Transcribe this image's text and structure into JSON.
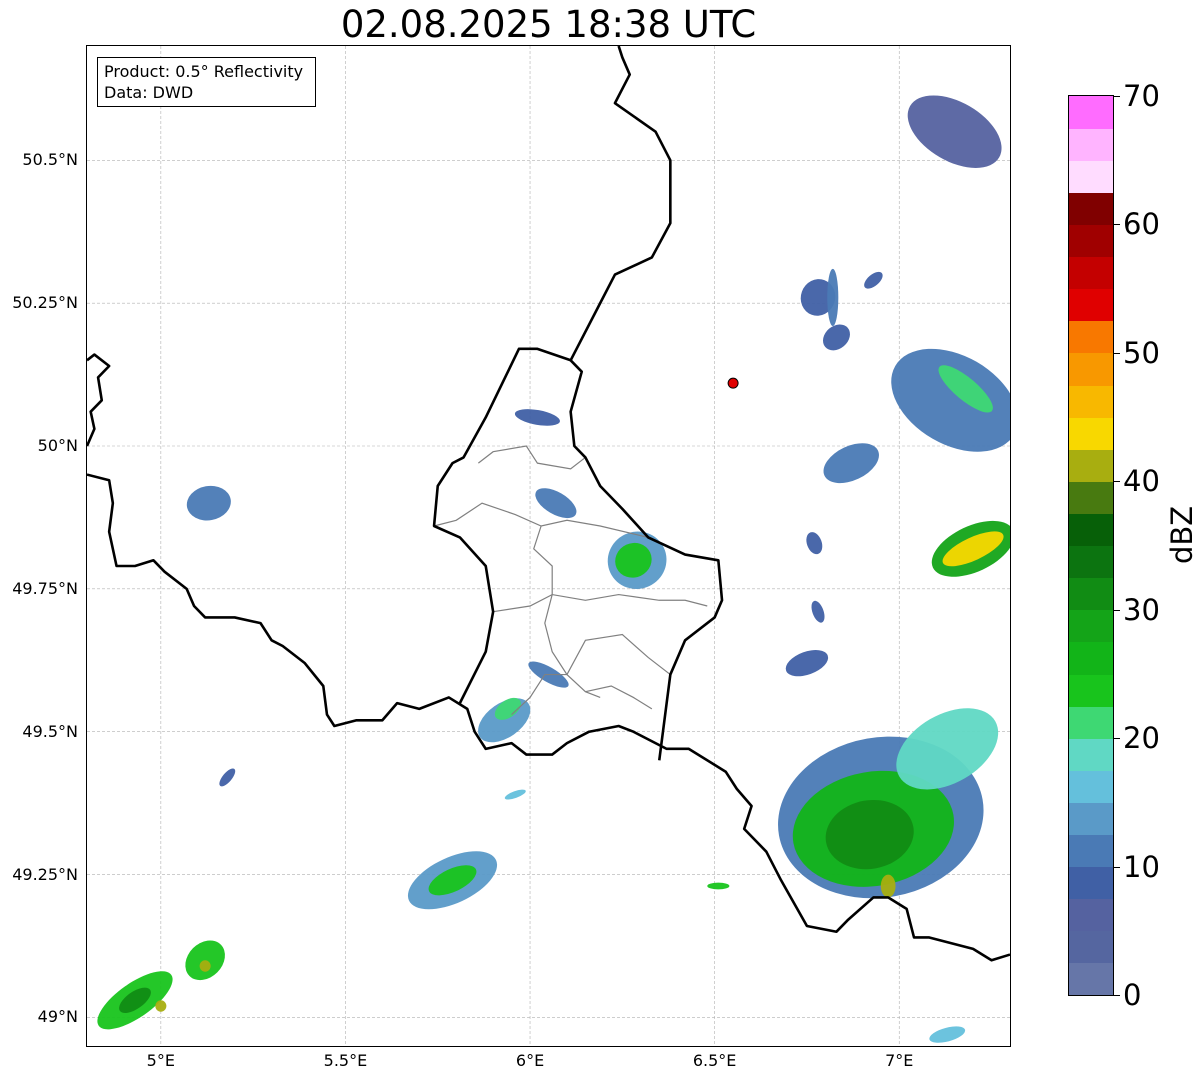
{
  "title": "02.08.2025 18:38 UTC",
  "info_box": {
    "product": "Product: 0.5° Reflectivity",
    "source": "Data: DWD"
  },
  "map": {
    "lon_range": [
      4.8,
      7.3
    ],
    "lat_range": [
      48.95,
      50.7
    ],
    "lat_ticks": [
      {
        "value": 49.0,
        "label": "49°N"
      },
      {
        "value": 49.25,
        "label": "49.25°N"
      },
      {
        "value": 49.5,
        "label": "49.5°N"
      },
      {
        "value": 49.75,
        "label": "49.75°N"
      },
      {
        "value": 50.0,
        "label": "50°N"
      },
      {
        "value": 50.25,
        "label": "50.25°N"
      },
      {
        "value": 50.5,
        "label": "50.5°N"
      }
    ],
    "lon_ticks": [
      {
        "value": 5.0,
        "label": "5°E"
      },
      {
        "value": 5.5,
        "label": "5.5°E"
      },
      {
        "value": 6.0,
        "label": "6°E"
      },
      {
        "value": 6.5,
        "label": "6.5°E"
      },
      {
        "value": 7.0,
        "label": "7°E"
      }
    ],
    "gridlines": true,
    "radar_site": {
      "lon": 6.55,
      "lat": 50.11,
      "color": "#e00000"
    },
    "border_color": "#000000",
    "district_color": "#808080",
    "national_borders": [
      [
        [
          4.8,
          50.15
        ],
        [
          4.82,
          50.16
        ],
        [
          4.86,
          50.14
        ],
        [
          4.83,
          50.12
        ],
        [
          4.84,
          50.08
        ],
        [
          4.81,
          50.06
        ],
        [
          4.82,
          50.03
        ],
        [
          4.8,
          50.0
        ]
      ],
      [
        [
          4.8,
          49.95
        ],
        [
          4.86,
          49.94
        ],
        [
          4.87,
          49.9
        ],
        [
          4.86,
          49.85
        ],
        [
          4.88,
          49.79
        ],
        [
          4.93,
          49.79
        ],
        [
          4.98,
          49.8
        ],
        [
          5.01,
          49.78
        ],
        [
          5.07,
          49.75
        ],
        [
          5.09,
          49.72
        ],
        [
          5.12,
          49.7
        ],
        [
          5.2,
          49.7
        ],
        [
          5.27,
          49.69
        ],
        [
          5.3,
          49.66
        ],
        [
          5.33,
          49.65
        ],
        [
          5.39,
          49.62
        ],
        [
          5.44,
          49.58
        ],
        [
          5.45,
          49.53
        ],
        [
          5.47,
          49.51
        ],
        [
          5.53,
          49.52
        ],
        [
          5.6,
          49.52
        ],
        [
          5.64,
          49.55
        ],
        [
          5.7,
          49.54
        ],
        [
          5.78,
          49.56
        ],
        [
          5.83,
          49.54
        ],
        [
          5.85,
          49.5
        ],
        [
          5.88,
          49.47
        ],
        [
          5.95,
          49.48
        ],
        [
          5.99,
          49.46
        ],
        [
          6.06,
          49.46
        ],
        [
          6.1,
          49.48
        ],
        [
          6.16,
          49.5
        ],
        [
          6.24,
          49.51
        ],
        [
          6.28,
          49.5
        ],
        [
          6.37,
          49.47
        ],
        [
          6.43,
          49.47
        ],
        [
          6.53,
          49.43
        ],
        [
          6.56,
          49.4
        ],
        [
          6.6,
          49.37
        ],
        [
          6.58,
          49.33
        ],
        [
          6.64,
          49.29
        ],
        [
          6.68,
          49.24
        ],
        [
          6.75,
          49.16
        ],
        [
          6.83,
          49.15
        ],
        [
          6.86,
          49.17
        ],
        [
          6.93,
          49.21
        ],
        [
          6.97,
          49.21
        ],
        [
          7.02,
          49.19
        ],
        [
          7.04,
          49.14
        ],
        [
          7.08,
          49.14
        ],
        [
          7.14,
          49.13
        ],
        [
          7.2,
          49.12
        ],
        [
          7.25,
          49.1
        ],
        [
          7.3,
          49.11
        ]
      ],
      [
        [
          5.81,
          49.55
        ],
        [
          5.88,
          49.64
        ],
        [
          5.9,
          49.71
        ],
        [
          5.88,
          49.79
        ],
        [
          5.81,
          49.84
        ],
        [
          5.74,
          49.86
        ],
        [
          5.75,
          49.93
        ],
        [
          5.79,
          49.97
        ],
        [
          5.82,
          49.98
        ],
        [
          5.88,
          50.05
        ],
        [
          5.97,
          50.17
        ],
        [
          6.02,
          50.17
        ],
        [
          6.11,
          50.15
        ],
        [
          6.14,
          50.13
        ],
        [
          6.11,
          50.06
        ],
        [
          6.12,
          50.0
        ],
        [
          6.15,
          49.98
        ],
        [
          6.19,
          49.93
        ],
        [
          6.25,
          49.89
        ],
        [
          6.32,
          49.84
        ],
        [
          6.42,
          49.81
        ],
        [
          6.51,
          49.8
        ],
        [
          6.52,
          49.73
        ],
        [
          6.5,
          49.7
        ],
        [
          6.42,
          49.66
        ],
        [
          6.38,
          49.6
        ],
        [
          6.37,
          49.55
        ],
        [
          6.35,
          49.45
        ]
      ],
      [
        [
          6.11,
          50.15
        ],
        [
          6.19,
          50.25
        ],
        [
          6.23,
          50.3
        ],
        [
          6.33,
          50.33
        ],
        [
          6.38,
          50.39
        ],
        [
          6.38,
          50.5
        ],
        [
          6.34,
          50.55
        ],
        [
          6.23,
          50.6
        ],
        [
          6.27,
          50.65
        ],
        [
          6.25,
          50.68
        ],
        [
          6.24,
          50.7
        ]
      ]
    ],
    "districts": [
      [
        [
          5.74,
          49.86
        ],
        [
          5.8,
          49.87
        ],
        [
          5.87,
          49.9
        ],
        [
          5.96,
          49.88
        ],
        [
          6.03,
          49.86
        ],
        [
          6.1,
          49.87
        ],
        [
          6.19,
          49.86
        ],
        [
          6.32,
          49.84
        ]
      ],
      [
        [
          5.86,
          49.97
        ],
        [
          5.9,
          49.99
        ],
        [
          5.99,
          50.0
        ],
        [
          6.02,
          49.97
        ],
        [
          6.11,
          49.96
        ],
        [
          6.15,
          49.98
        ]
      ],
      [
        [
          6.03,
          49.86
        ],
        [
          6.01,
          49.82
        ],
        [
          6.06,
          49.79
        ],
        [
          6.06,
          49.74
        ],
        [
          6.04,
          49.69
        ],
        [
          6.06,
          49.64
        ],
        [
          6.1,
          49.6
        ],
        [
          6.15,
          49.57
        ],
        [
          6.19,
          49.56
        ]
      ],
      [
        [
          5.9,
          49.71
        ],
        [
          6.0,
          49.72
        ],
        [
          6.06,
          49.74
        ],
        [
          6.15,
          49.73
        ],
        [
          6.24,
          49.74
        ],
        [
          6.35,
          49.73
        ],
        [
          6.42,
          49.73
        ],
        [
          6.48,
          49.72
        ]
      ],
      [
        [
          6.1,
          49.6
        ],
        [
          6.15,
          49.66
        ],
        [
          6.25,
          49.67
        ],
        [
          6.32,
          49.63
        ],
        [
          6.38,
          49.6
        ]
      ],
      [
        [
          5.95,
          49.53
        ],
        [
          6.0,
          49.56
        ],
        [
          6.04,
          49.6
        ],
        [
          6.1,
          49.6
        ]
      ],
      [
        [
          6.15,
          49.57
        ],
        [
          6.22,
          49.58
        ],
        [
          6.28,
          49.56
        ],
        [
          6.33,
          49.54
        ]
      ]
    ]
  },
  "radar_cells": [
    {
      "lon": 7.15,
      "lat": 50.55,
      "rx": 0.08,
      "ry": 0.09,
      "angle": 60,
      "dbz": 7
    },
    {
      "lon": 6.78,
      "lat": 50.26,
      "rx": 0.05,
      "ry": 0.03,
      "angle": 70,
      "dbz": 8
    },
    {
      "lon": 6.83,
      "lat": 50.19,
      "rx": 0.04,
      "ry": 0.02,
      "angle": 40,
      "dbz": 9
    },
    {
      "lon": 6.93,
      "lat": 50.29,
      "rx": 0.03,
      "ry": 0.01,
      "angle": 40,
      "dbz": 8
    },
    {
      "lon": 7.15,
      "lat": 50.08,
      "rx": 0.12,
      "ry": 0.12,
      "angle": 60,
      "dbz": 12
    },
    {
      "lon": 7.18,
      "lat": 50.1,
      "rx": 0.03,
      "ry": 0.06,
      "angle": 50,
      "dbz": 22
    },
    {
      "lon": 6.87,
      "lat": 49.97,
      "rx": 0.08,
      "ry": 0.03,
      "angle": 25,
      "dbz": 11
    },
    {
      "lon": 7.2,
      "lat": 49.82,
      "rx": 0.12,
      "ry": 0.04,
      "angle": 25,
      "dbz": 28
    },
    {
      "lon": 7.2,
      "lat": 49.82,
      "rx": 0.09,
      "ry": 0.02,
      "angle": 25,
      "dbz": 44
    },
    {
      "lon": 6.95,
      "lat": 49.35,
      "rx": 0.28,
      "ry": 0.14,
      "angle": 10,
      "dbz": 12
    },
    {
      "lon": 6.93,
      "lat": 49.33,
      "rx": 0.22,
      "ry": 0.1,
      "angle": 10,
      "dbz": 25
    },
    {
      "lon": 6.92,
      "lat": 49.32,
      "rx": 0.12,
      "ry": 0.06,
      "angle": 10,
      "dbz": 32
    },
    {
      "lon": 6.97,
      "lat": 49.23,
      "rx": 0.02,
      "ry": 0.02,
      "angle": 0,
      "dbz": 42
    },
    {
      "lon": 7.13,
      "lat": 49.47,
      "rx": 0.15,
      "ry": 0.06,
      "angle": 30,
      "dbz": 18
    },
    {
      "lon": 6.29,
      "lat": 49.8,
      "rx": 0.08,
      "ry": 0.05,
      "angle": 25,
      "dbz": 14
    },
    {
      "lon": 6.28,
      "lat": 49.8,
      "rx": 0.05,
      "ry": 0.03,
      "angle": 25,
      "dbz": 24
    },
    {
      "lon": 6.07,
      "lat": 49.9,
      "rx": 0.03,
      "ry": 0.04,
      "angle": 60,
      "dbz": 11
    },
    {
      "lon": 6.02,
      "lat": 50.05,
      "rx": 0.02,
      "ry": 0.04,
      "angle": 80,
      "dbz": 8
    },
    {
      "lon": 6.05,
      "lat": 49.6,
      "rx": 0.02,
      "ry": 0.04,
      "angle": 60,
      "dbz": 10
    },
    {
      "lon": 5.93,
      "lat": 49.52,
      "rx": 0.08,
      "ry": 0.03,
      "angle": 35,
      "dbz": 14
    },
    {
      "lon": 5.94,
      "lat": 49.54,
      "rx": 0.04,
      "ry": 0.015,
      "angle": 35,
      "dbz": 20
    },
    {
      "lon": 5.79,
      "lat": 49.24,
      "rx": 0.13,
      "ry": 0.04,
      "angle": 25,
      "dbz": 14
    },
    {
      "lon": 5.79,
      "lat": 49.24,
      "rx": 0.07,
      "ry": 0.02,
      "angle": 25,
      "dbz": 24
    },
    {
      "lon": 5.12,
      "lat": 49.1,
      "rx": 0.06,
      "ry": 0.03,
      "angle": 45,
      "dbz": 24
    },
    {
      "lon": 5.12,
      "lat": 49.09,
      "rx": 0.015,
      "ry": 0.01,
      "angle": 0,
      "dbz": 42
    },
    {
      "lon": 4.93,
      "lat": 49.03,
      "rx": 0.12,
      "ry": 0.03,
      "angle": 35,
      "dbz": 24
    },
    {
      "lon": 4.93,
      "lat": 49.03,
      "rx": 0.05,
      "ry": 0.015,
      "angle": 35,
      "dbz": 32
    },
    {
      "lon": 5.0,
      "lat": 49.02,
      "rx": 0.015,
      "ry": 0.01,
      "angle": 0,
      "dbz": 42
    },
    {
      "lon": 5.13,
      "lat": 49.9,
      "rx": 0.06,
      "ry": 0.03,
      "angle": 10,
      "dbz": 10
    },
    {
      "lon": 5.18,
      "lat": 49.42,
      "rx": 0.03,
      "ry": 0.008,
      "angle": 50,
      "dbz": 8
    },
    {
      "lon": 6.51,
      "lat": 49.23,
      "rx": 0.03,
      "ry": 0.006,
      "angle": 0,
      "dbz": 24
    },
    {
      "lon": 7.13,
      "lat": 48.97,
      "rx": 0.05,
      "ry": 0.012,
      "angle": 15,
      "dbz": 15
    },
    {
      "lon": 6.77,
      "lat": 49.83,
      "rx": 0.02,
      "ry": 0.02,
      "angle": 20,
      "dbz": 9
    },
    {
      "lon": 6.75,
      "lat": 49.62,
      "rx": 0.06,
      "ry": 0.02,
      "angle": 20,
      "dbz": 9
    },
    {
      "lon": 6.78,
      "lat": 49.71,
      "rx": 0.015,
      "ry": 0.02,
      "angle": 20,
      "dbz": 8
    },
    {
      "lon": 5.96,
      "lat": 49.39,
      "rx": 0.03,
      "ry": 0.006,
      "angle": 20,
      "dbz": 17
    },
    {
      "lon": 6.82,
      "lat": 50.26,
      "rx": 0.015,
      "ry": 0.05,
      "angle": 0,
      "dbz": 10
    }
  ],
  "colorbar": {
    "label": "dBZ",
    "min": 0,
    "max": 70,
    "step": 2.5,
    "ticks": [
      {
        "value": 0,
        "label": "0"
      },
      {
        "value": 10,
        "label": "10"
      },
      {
        "value": 20,
        "label": "20"
      },
      {
        "value": 30,
        "label": "30"
      },
      {
        "value": 40,
        "label": "40"
      },
      {
        "value": 50,
        "label": "50"
      },
      {
        "value": 60,
        "label": "60"
      },
      {
        "value": 70,
        "label": "70"
      }
    ],
    "colors": [
      "#6676a8",
      "#5566a0",
      "#5562a0",
      "#4060a5",
      "#4a7ab5",
      "#5a9ac8",
      "#64c0dc",
      "#60d8c4",
      "#3ed873",
      "#18c41c",
      "#12b418",
      "#14a418",
      "#118c14",
      "#0c7410",
      "#076008",
      "#487a10",
      "#a8ae10",
      "#f8d800",
      "#f8b800",
      "#f89800",
      "#f87800",
      "#e00000",
      "#c40000",
      "#a00000",
      "#800000",
      "#ffdcff",
      "#ffb4ff",
      "#ff6cff"
    ]
  }
}
